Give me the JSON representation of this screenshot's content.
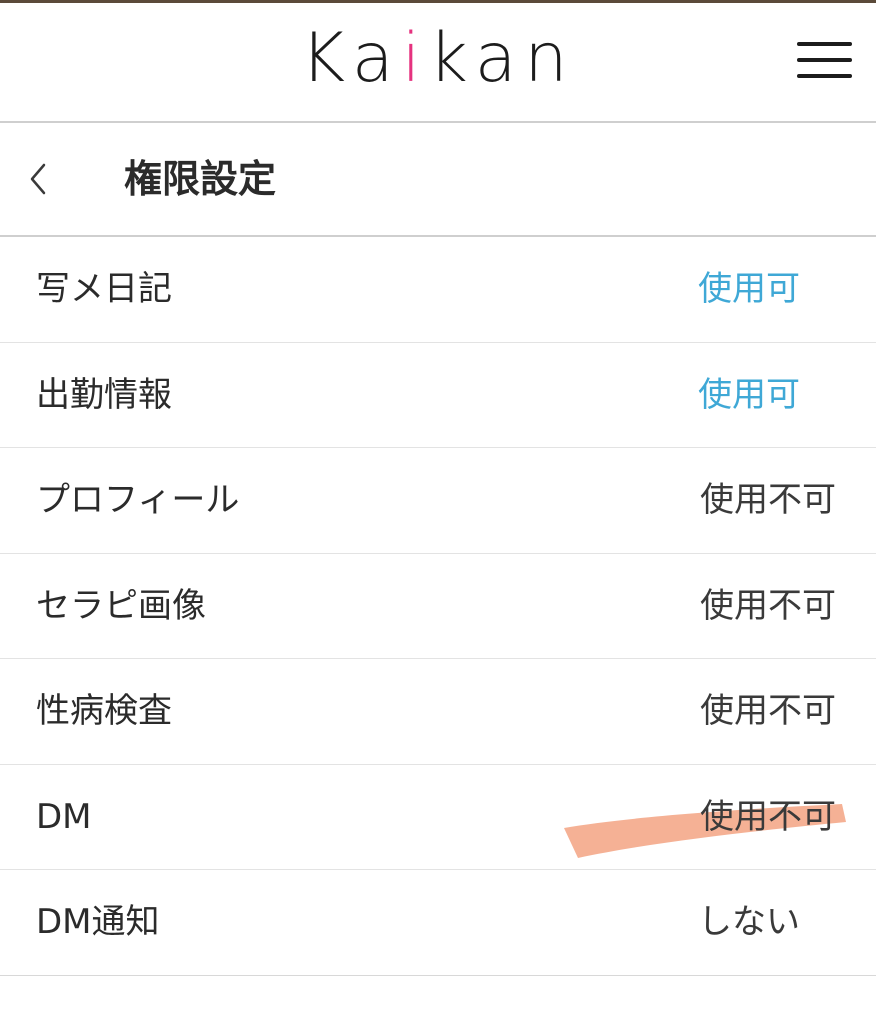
{
  "header": {
    "logo_prefix": "Ka",
    "logo_accent": "i",
    "logo_suffix": "kan",
    "accent_color": "#e5327f"
  },
  "subheader": {
    "title": "権限設定"
  },
  "permissions": [
    {
      "label": "写メ日記",
      "value": "使用可",
      "state": "enabled"
    },
    {
      "label": "出勤情報",
      "value": "使用可",
      "state": "enabled"
    },
    {
      "label": "プロフィール",
      "value": "使用不可",
      "state": "disabled"
    },
    {
      "label": "セラピ画像",
      "value": "使用不可",
      "state": "disabled"
    },
    {
      "label": "性病検査",
      "value": "使用不可",
      "state": "disabled"
    },
    {
      "label": "DM",
      "value": "使用不可",
      "state": "disabled"
    },
    {
      "label": "DM通知",
      "value": "しない",
      "state": "off"
    }
  ],
  "colors": {
    "enabled_value": "#3fa8d6",
    "highlight_marker": "#f4a98a"
  },
  "icons": {
    "menu": "hamburger-menu-icon",
    "back": "chevron-left-icon"
  }
}
